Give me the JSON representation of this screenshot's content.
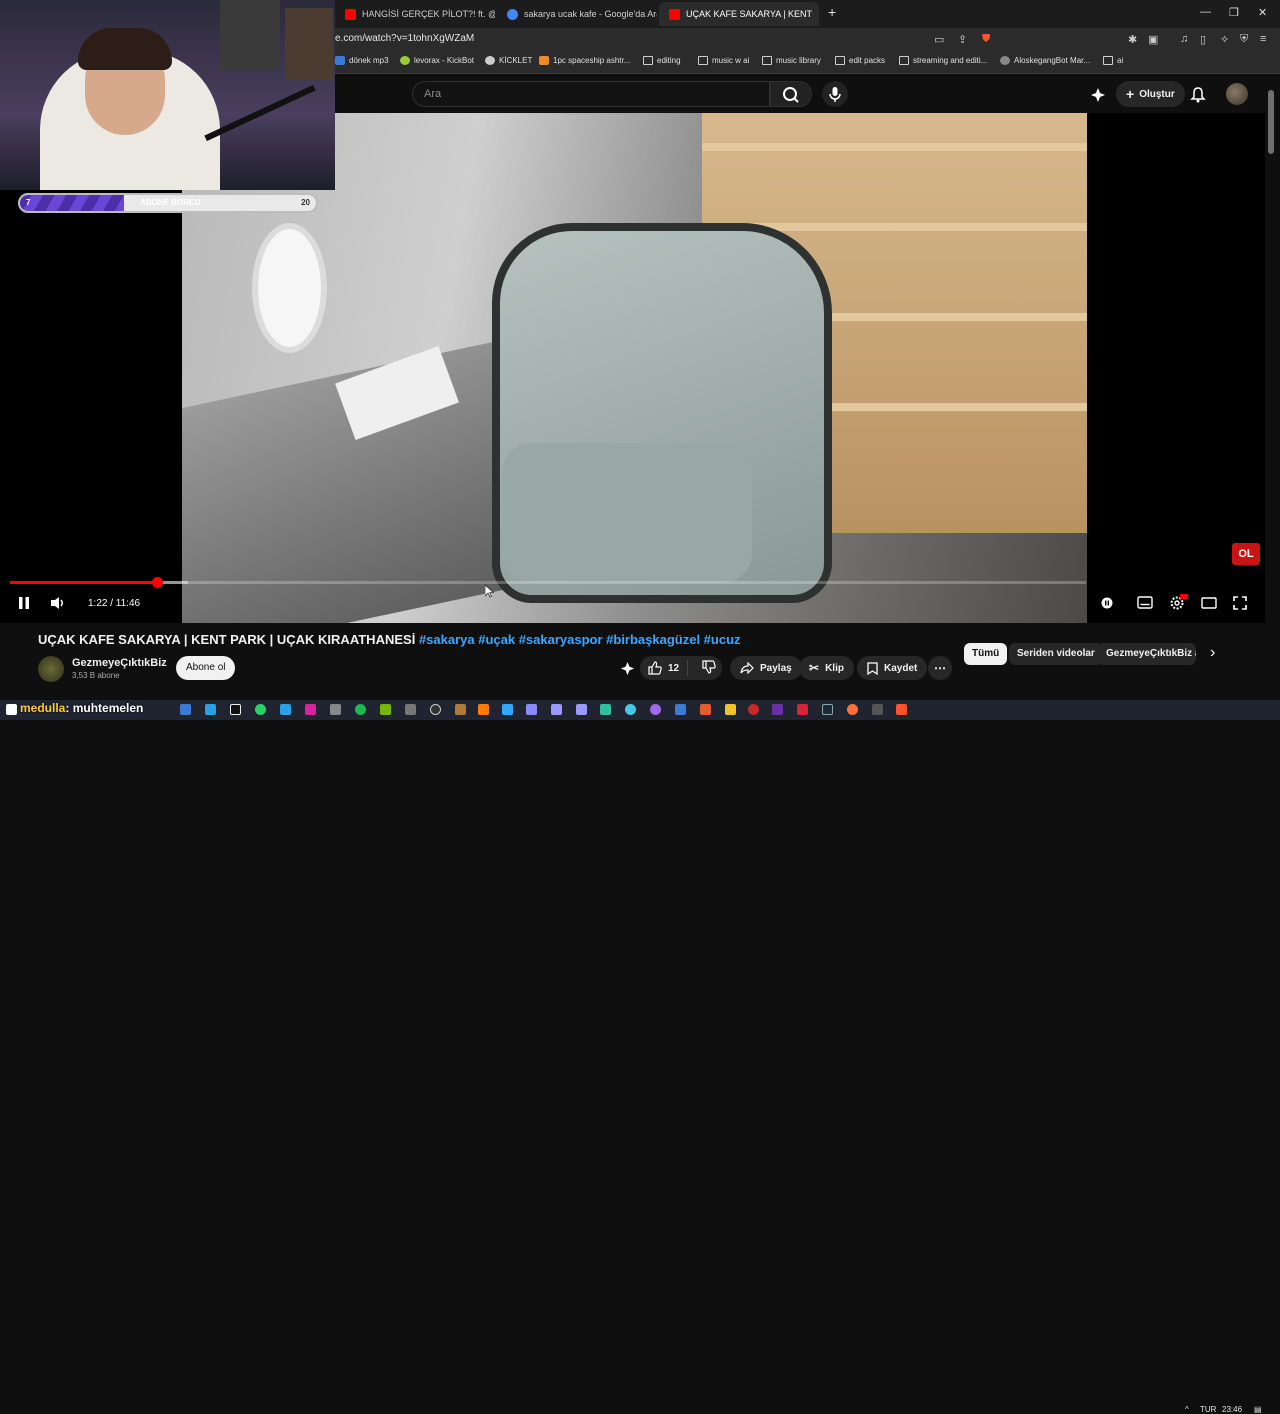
{
  "tabs": [
    {
      "label": "HANGİSİ GERÇEK PİLOT?! ft. @AyriS...",
      "color": "#ff0000",
      "active": false
    },
    {
      "label": "sakarya ucak kafe - Google'da Ara",
      "color": "#4285f4",
      "active": false
    },
    {
      "label": "UÇAK KAFE SAKARYA | KENT",
      "color": "#ff0000",
      "active": true
    }
  ],
  "address": {
    "url": "e.com/watch?v=1tohnXgWZaM"
  },
  "bookmarks": [
    {
      "label": "dönek mp3",
      "icon": "link-icon"
    },
    {
      "label": "levorax - KickBot",
      "icon": "kickbot-icon"
    },
    {
      "label": "KİCKLET",
      "icon": "kicklet-icon"
    },
    {
      "label": "1pc spaceship ashtr...",
      "icon": "shop-icon"
    },
    {
      "label": "editing",
      "icon": "folder-icon"
    },
    {
      "label": "music w ai",
      "icon": "folder-icon"
    },
    {
      "label": "music library",
      "icon": "folder-icon"
    },
    {
      "label": "edit packs",
      "icon": "folder-icon"
    },
    {
      "label": "streaming and editi...",
      "icon": "folder-icon"
    },
    {
      "label": "AloskegangBot Mar...",
      "icon": "bot-icon"
    },
    {
      "label": "ai",
      "icon": "folder-icon"
    }
  ],
  "header": {
    "search_placeholder": "Ara",
    "create_label": "Oluştur"
  },
  "facecam": {
    "goal_title": "ABONE BORCU",
    "goal_current": "7",
    "goal_target": "20",
    "goal_fraction": 0.35
  },
  "player": {
    "time": "1:22 / 11:46",
    "played_fraction": 0.1366,
    "buffered_fraction": 0.165,
    "subscribe_badge": "OL"
  },
  "video": {
    "title_main": "UÇAK KAFE SAKARYA | KENT PARK | UÇAK KIRAATHANESİ",
    "hashtags": "#sakarya #uçak #sakaryaspor #birbaşkagüzel #ucuz",
    "channel_name": "GezmeyeÇıktıkBiz",
    "subscribers": "3,53 B abone",
    "subscribe_label": "Abone ol",
    "likes": "12",
    "share_label": "Paylaş",
    "clip_label": "Klip",
    "save_label": "Kaydet"
  },
  "chips": [
    "Tümü",
    "Seriden videolar",
    "GezmeyeÇıktıkBiz ad"
  ],
  "overlay": {
    "name": "medulla",
    "message": ": muhtemelen"
  },
  "tray": {
    "lang": "TUR",
    "clock": "23:46"
  }
}
